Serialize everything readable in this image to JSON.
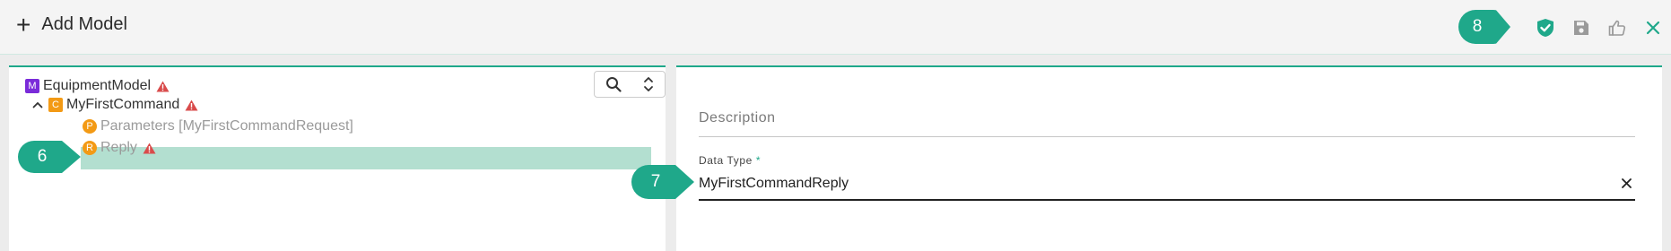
{
  "header": {
    "add_symbol": "+",
    "title": "Add Model",
    "actions": [
      {
        "icon": "shield-check-icon"
      },
      {
        "icon": "save-icon"
      },
      {
        "icon": "thumbs-up-icon"
      },
      {
        "icon": "close-icon"
      }
    ]
  },
  "markers": {
    "m8": "8",
    "m6": "6",
    "m7": "7"
  },
  "tree": {
    "tools": {
      "search_icon": "search-icon",
      "expand_icon": "expand-collapse-icon"
    },
    "items": [
      {
        "badge": "M",
        "label": "EquipmentModel",
        "warning": true
      },
      {
        "badge": "C",
        "label": "MyFirstCommand",
        "warning": true,
        "expanded": true
      },
      {
        "badge": "P",
        "label": "Parameters [MyFirstCommandRequest]",
        "warning": false
      },
      {
        "badge": "R",
        "label": "Reply",
        "warning": true,
        "selected": true
      }
    ]
  },
  "form": {
    "description_label": "Description",
    "data_type_label": "Data Type",
    "required_mark": "*",
    "data_type_value": "MyFirstCommandReply"
  },
  "colors": {
    "accent": "#1fa88a",
    "selection": "#b3dfd0",
    "model_badge": "#7a2bd9",
    "item_badge": "#f39a15",
    "warning": "#d94b4b"
  }
}
